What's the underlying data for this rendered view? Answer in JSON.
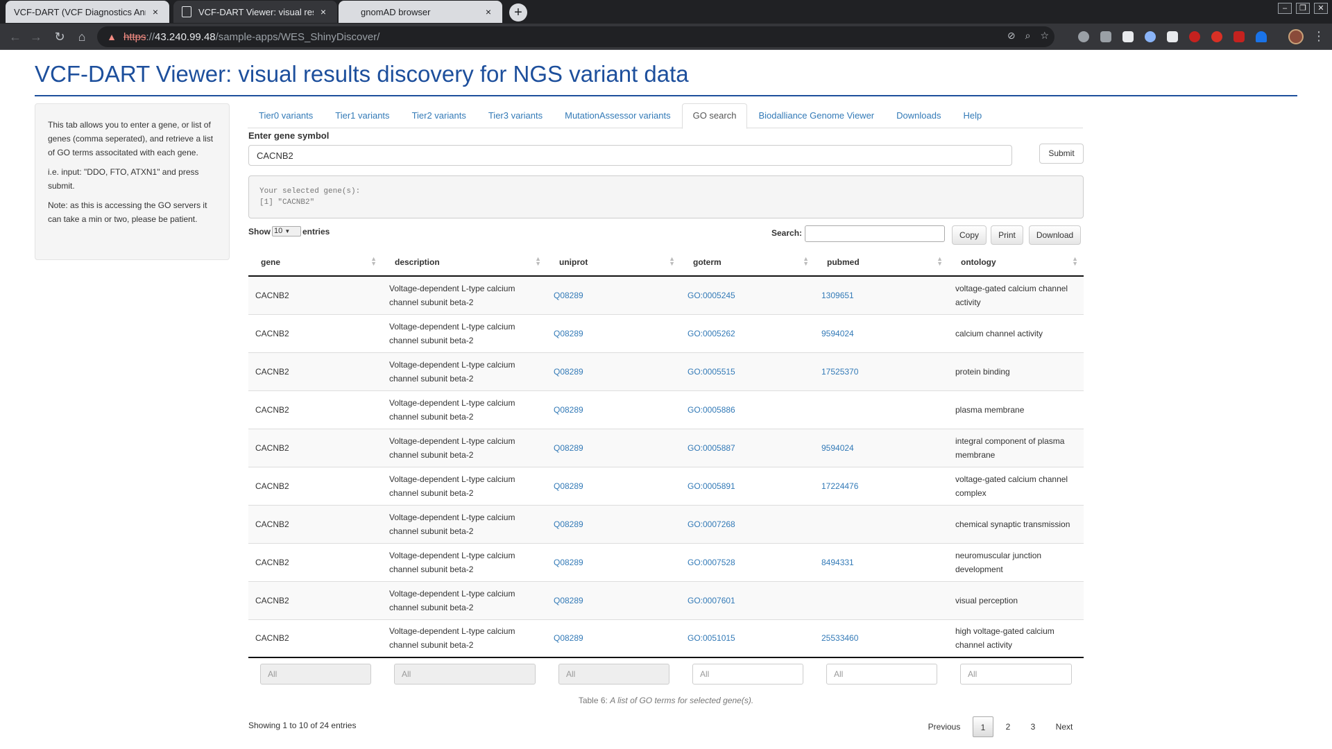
{
  "browser": {
    "tabs": [
      {
        "title": "VCF-DART (VCF Diagnostics Ann",
        "close": "×"
      },
      {
        "title": "VCF-DART Viewer: visual results",
        "close": "×"
      },
      {
        "title": "gnomAD browser",
        "close": "×"
      }
    ],
    "new_tab": "+",
    "window_buttons": [
      "–",
      "❐",
      "✕"
    ],
    "url_scheme": "https",
    "url_sep": "://",
    "url_host": "43.240.99.48",
    "url_path": "/sample-apps/WES_ShinyDiscover/",
    "nav_glyphs": {
      "back": "←",
      "forward": "→",
      "reload": "↻",
      "home": "⌂",
      "menu": "⋮",
      "warning": "▲"
    },
    "omnibox_icons": [
      "⊘",
      "⌕",
      "☆"
    ],
    "extension_colors": [
      "#9aa0a6",
      "#9aa0a6",
      "#e8eaed",
      "#8ab4f8",
      "#e8eaed",
      "#c5221f",
      "#d93025",
      "#c5221f",
      "#1a73e8"
    ]
  },
  "page": {
    "title": "VCF-DART Viewer: visual results discovery for NGS variant data",
    "accent": "#1d4f9c"
  },
  "sidebar": {
    "p1": "This tab allows you to enter a gene, or list of genes (comma seperated), and retrieve a list of GO terms associtated with each gene.",
    "p2": "i.e. input: \"DDO, FTO, ATXN1\" and press submit.",
    "p3": "Note: as this is accessing the GO servers it can take a min or two, please be patient."
  },
  "tabs": [
    "Tier0 variants",
    "Tier1 variants",
    "Tier2 variants",
    "Tier3 variants",
    "MutationAssessor variants",
    "GO search",
    "Biodalliance Genome Viewer",
    "Downloads",
    "Help"
  ],
  "active_tab": "GO search",
  "gene_form": {
    "label": "Enter gene symbol",
    "value": "CACNB2",
    "submit": "Submit"
  },
  "output": {
    "line1": "Your selected gene(s):",
    "line2": "[1] \"CACNB2\""
  },
  "table_controls": {
    "show": "Show",
    "length": "10",
    "entries": "entries",
    "search_label": "Search:",
    "search_value": "",
    "buttons": [
      "Copy",
      "Print",
      "Download"
    ]
  },
  "table": {
    "columns": [
      "gene",
      "description",
      "uniprot",
      "goterm",
      "pubmed",
      "ontology"
    ],
    "rows": [
      {
        "gene": "CACNB2",
        "description": "Voltage-dependent L-type calcium channel subunit beta-2",
        "uniprot": "Q08289",
        "goterm": "GO:0005245",
        "pubmed": "1309651",
        "ontology": "voltage-gated calcium channel activity"
      },
      {
        "gene": "CACNB2",
        "description": "Voltage-dependent L-type calcium channel subunit beta-2",
        "uniprot": "Q08289",
        "goterm": "GO:0005262",
        "pubmed": "9594024",
        "ontology": "calcium channel activity"
      },
      {
        "gene": "CACNB2",
        "description": "Voltage-dependent L-type calcium channel subunit beta-2",
        "uniprot": "Q08289",
        "goterm": "GO:0005515",
        "pubmed": "17525370",
        "ontology": "protein binding"
      },
      {
        "gene": "CACNB2",
        "description": "Voltage-dependent L-type calcium channel subunit beta-2",
        "uniprot": "Q08289",
        "goterm": "GO:0005886",
        "pubmed": "",
        "ontology": "plasma membrane"
      },
      {
        "gene": "CACNB2",
        "description": "Voltage-dependent L-type calcium channel subunit beta-2",
        "uniprot": "Q08289",
        "goterm": "GO:0005887",
        "pubmed": "9594024",
        "ontology": "integral component of plasma membrane"
      },
      {
        "gene": "CACNB2",
        "description": "Voltage-dependent L-type calcium channel subunit beta-2",
        "uniprot": "Q08289",
        "goterm": "GO:0005891",
        "pubmed": "17224476",
        "ontology": "voltage-gated calcium channel complex"
      },
      {
        "gene": "CACNB2",
        "description": "Voltage-dependent L-type calcium channel subunit beta-2",
        "uniprot": "Q08289",
        "goterm": "GO:0007268",
        "pubmed": "",
        "ontology": "chemical synaptic transmission"
      },
      {
        "gene": "CACNB2",
        "description": "Voltage-dependent L-type calcium channel subunit beta-2",
        "uniprot": "Q08289",
        "goterm": "GO:0007528",
        "pubmed": "8494331",
        "ontology": "neuromuscular junction development"
      },
      {
        "gene": "CACNB2",
        "description": "Voltage-dependent L-type calcium channel subunit beta-2",
        "uniprot": "Q08289",
        "goterm": "GO:0007601",
        "pubmed": "",
        "ontology": "visual perception"
      },
      {
        "gene": "CACNB2",
        "description": "Voltage-dependent L-type calcium channel subunit beta-2",
        "uniprot": "Q08289",
        "goterm": "GO:0051015",
        "pubmed": "25533460",
        "ontology": "high voltage-gated calcium channel activity"
      }
    ],
    "filter_placeholders": [
      "All",
      "All",
      "All",
      "All",
      "All",
      "All"
    ],
    "caption_prefix": "Table 6:",
    "caption_text": "A list of GO terms for selected gene(s).",
    "info": "Showing 1 to 10 of 24 entries",
    "pagination": {
      "previous": "Previous",
      "pages": [
        "1",
        "2",
        "3"
      ],
      "current": "1",
      "next": "Next"
    }
  }
}
